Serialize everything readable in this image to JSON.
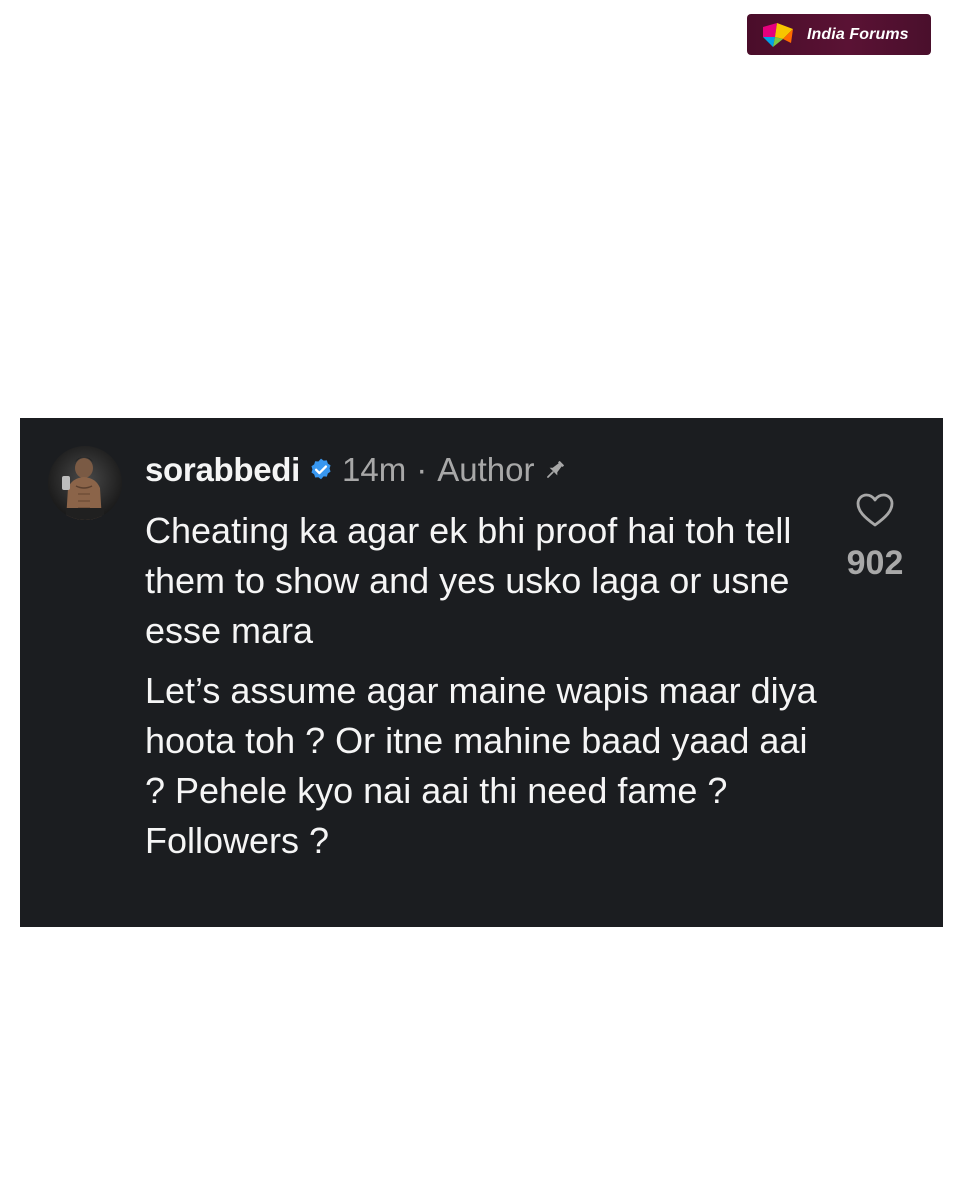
{
  "brand": {
    "name": "India Forums",
    "logo_icon": "india-forums-logo-icon"
  },
  "comment": {
    "username": "sorabbedi",
    "verified_icon": "verified-badge-icon",
    "time": "14m",
    "separator": "·",
    "role": "Author",
    "pin_icon": "pin-icon",
    "avatar": "profile-photo",
    "paragraphs": [
      "Cheating ka agar ek bhi proof hai toh tell them to show and yes usko laga or usne esse mara",
      "Let’s assume agar maine wapis maar diya hoota toh ? Or itne mahine baad yaad aai ? Pehele kyo nai aai thi need fame ? Followers ?"
    ],
    "likes": {
      "icon": "heart-icon",
      "count": "902"
    }
  },
  "colors": {
    "card_background": "#1b1d20",
    "text_primary": "#f5f5f5",
    "text_secondary": "#a8a8a8",
    "verified_blue": "#3897f0",
    "brand_background": "#4a0d2a"
  }
}
